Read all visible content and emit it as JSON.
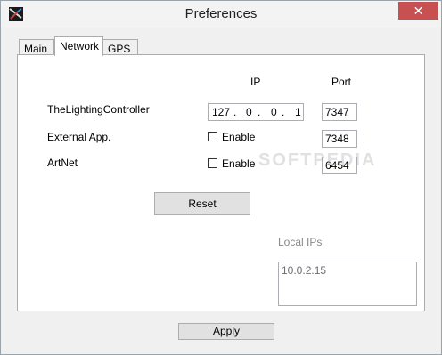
{
  "window": {
    "title": "Preferences",
    "close_glyph": "✕"
  },
  "tabs": [
    {
      "label": "Main"
    },
    {
      "label": "Network"
    },
    {
      "label": "GPS"
    }
  ],
  "network": {
    "col_ip": "IP",
    "col_port": "Port",
    "rows": [
      {
        "label": "TheLightingController",
        "ip": [
          "127",
          "0",
          "0",
          "1"
        ],
        "port": "7347"
      },
      {
        "label": "External App.",
        "enable_label": "Enable",
        "enabled": false,
        "port": "7348"
      },
      {
        "label": "ArtNet",
        "enable_label": "Enable",
        "enabled": false,
        "port": "6454"
      }
    ],
    "reset_label": "Reset",
    "local_ips_label": "Local IPs",
    "local_ips": "10.0.2.15",
    "watermark": "SOFTPEDIA"
  },
  "footer": {
    "apply_label": "Apply"
  },
  "icons": {
    "app": "app-logo-icon",
    "close": "close-icon"
  },
  "colors": {
    "close_bg": "#c75050",
    "panel_bg": "#ffffff",
    "window_bg": "#f0f0f0"
  }
}
